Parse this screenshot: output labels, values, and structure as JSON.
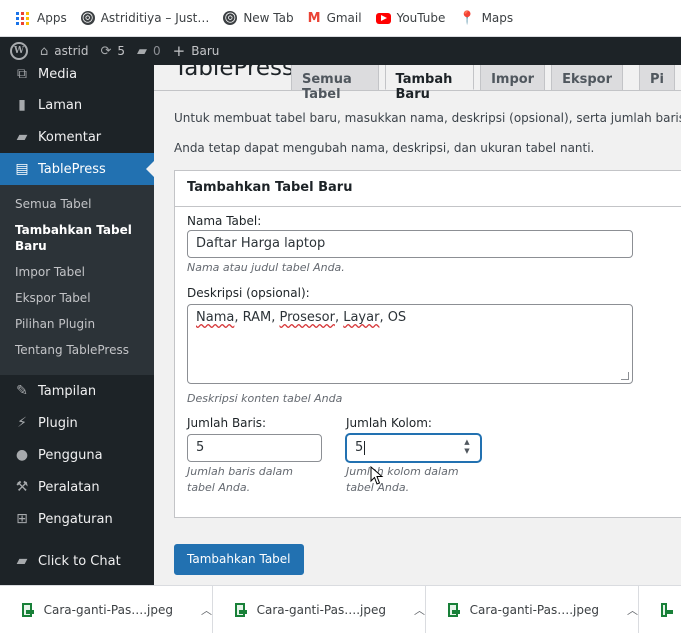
{
  "bookmarks": [
    {
      "label": "Apps",
      "icon": "apps-grid-icon"
    },
    {
      "label": "Astriditiya – Just…",
      "icon": "globe-icon"
    },
    {
      "label": "New Tab",
      "icon": "globe-icon"
    },
    {
      "label": "Gmail",
      "icon": "gmail-icon"
    },
    {
      "label": "YouTube",
      "icon": "youtube-icon"
    },
    {
      "label": "Maps",
      "icon": "maps-pin-icon"
    }
  ],
  "adminbar": {
    "site_name": "astrid",
    "updates_count": "5",
    "comments_count": "0",
    "new_label": "Baru"
  },
  "sidebar": {
    "items_top": [
      {
        "label": "Media",
        "icon": "media-icon"
      },
      {
        "label": "Laman",
        "icon": "page-icon"
      },
      {
        "label": "Komentar",
        "icon": "comment-icon"
      }
    ],
    "active": {
      "label": "TablePress",
      "icon": "table-icon"
    },
    "submenu": [
      {
        "label": "Semua Tabel"
      },
      {
        "label": "Tambahkan Tabel Baru"
      },
      {
        "label": "Impor Tabel"
      },
      {
        "label": "Ekspor Tabel"
      },
      {
        "label": "Pilihan Plugin"
      },
      {
        "label": "Tentang TablePress"
      }
    ],
    "items_bottom": [
      {
        "label": "Tampilan",
        "icon": "brush-icon"
      },
      {
        "label": "Plugin",
        "icon": "plugin-icon"
      },
      {
        "label": "Pengguna",
        "icon": "user-icon"
      },
      {
        "label": "Peralatan",
        "icon": "wrench-icon"
      },
      {
        "label": "Pengaturan",
        "icon": "settings-icon"
      },
      {
        "label": "Click to Chat",
        "icon": "chat-icon"
      }
    ]
  },
  "main": {
    "page_title": "TablePress",
    "tabs": [
      "Semua Tabel",
      "Tambah Baru",
      "Impor",
      "Ekspor",
      "Pi"
    ],
    "intro1": "Untuk membuat tabel baru, masukkan nama, deskripsi (opsional), serta jumlah baris dan kolom",
    "intro2": "Anda tetap dapat mengubah nama, deskripsi, dan ukuran tabel nanti.",
    "box_title": "Tambahkan Tabel Baru",
    "name_label": "Nama Tabel:",
    "name_value": "Daftar Harga laptop",
    "name_desc": "Nama atau judul tabel Anda.",
    "desc_label": "Deskripsi (opsional):",
    "desc_words": [
      "Nama",
      ", RAM, ",
      "Prosesor",
      ", ",
      "Layar",
      ", OS"
    ],
    "desc_help": "Deskripsi konten tabel Anda",
    "rows_label": "Jumlah Baris:",
    "rows_value": "5",
    "rows_help": "Jumlah baris dalam tabel Anda.",
    "cols_label": "Jumlah Kolom:",
    "cols_value": "5",
    "cols_help": "Jumlah kolom dalam tabel Anda.",
    "submit_label": "Tambahkan Tabel"
  },
  "downloads": [
    {
      "name": "Cara-ganti-Pas….jpeg"
    },
    {
      "name": "Cara-ganti-Pas….jpeg"
    },
    {
      "name": "Cara-ganti-Pas….jpeg"
    }
  ],
  "colors": {
    "admin_bg": "#1d2327",
    "accent": "#2271b1",
    "page_bg": "#f1f1f1"
  }
}
